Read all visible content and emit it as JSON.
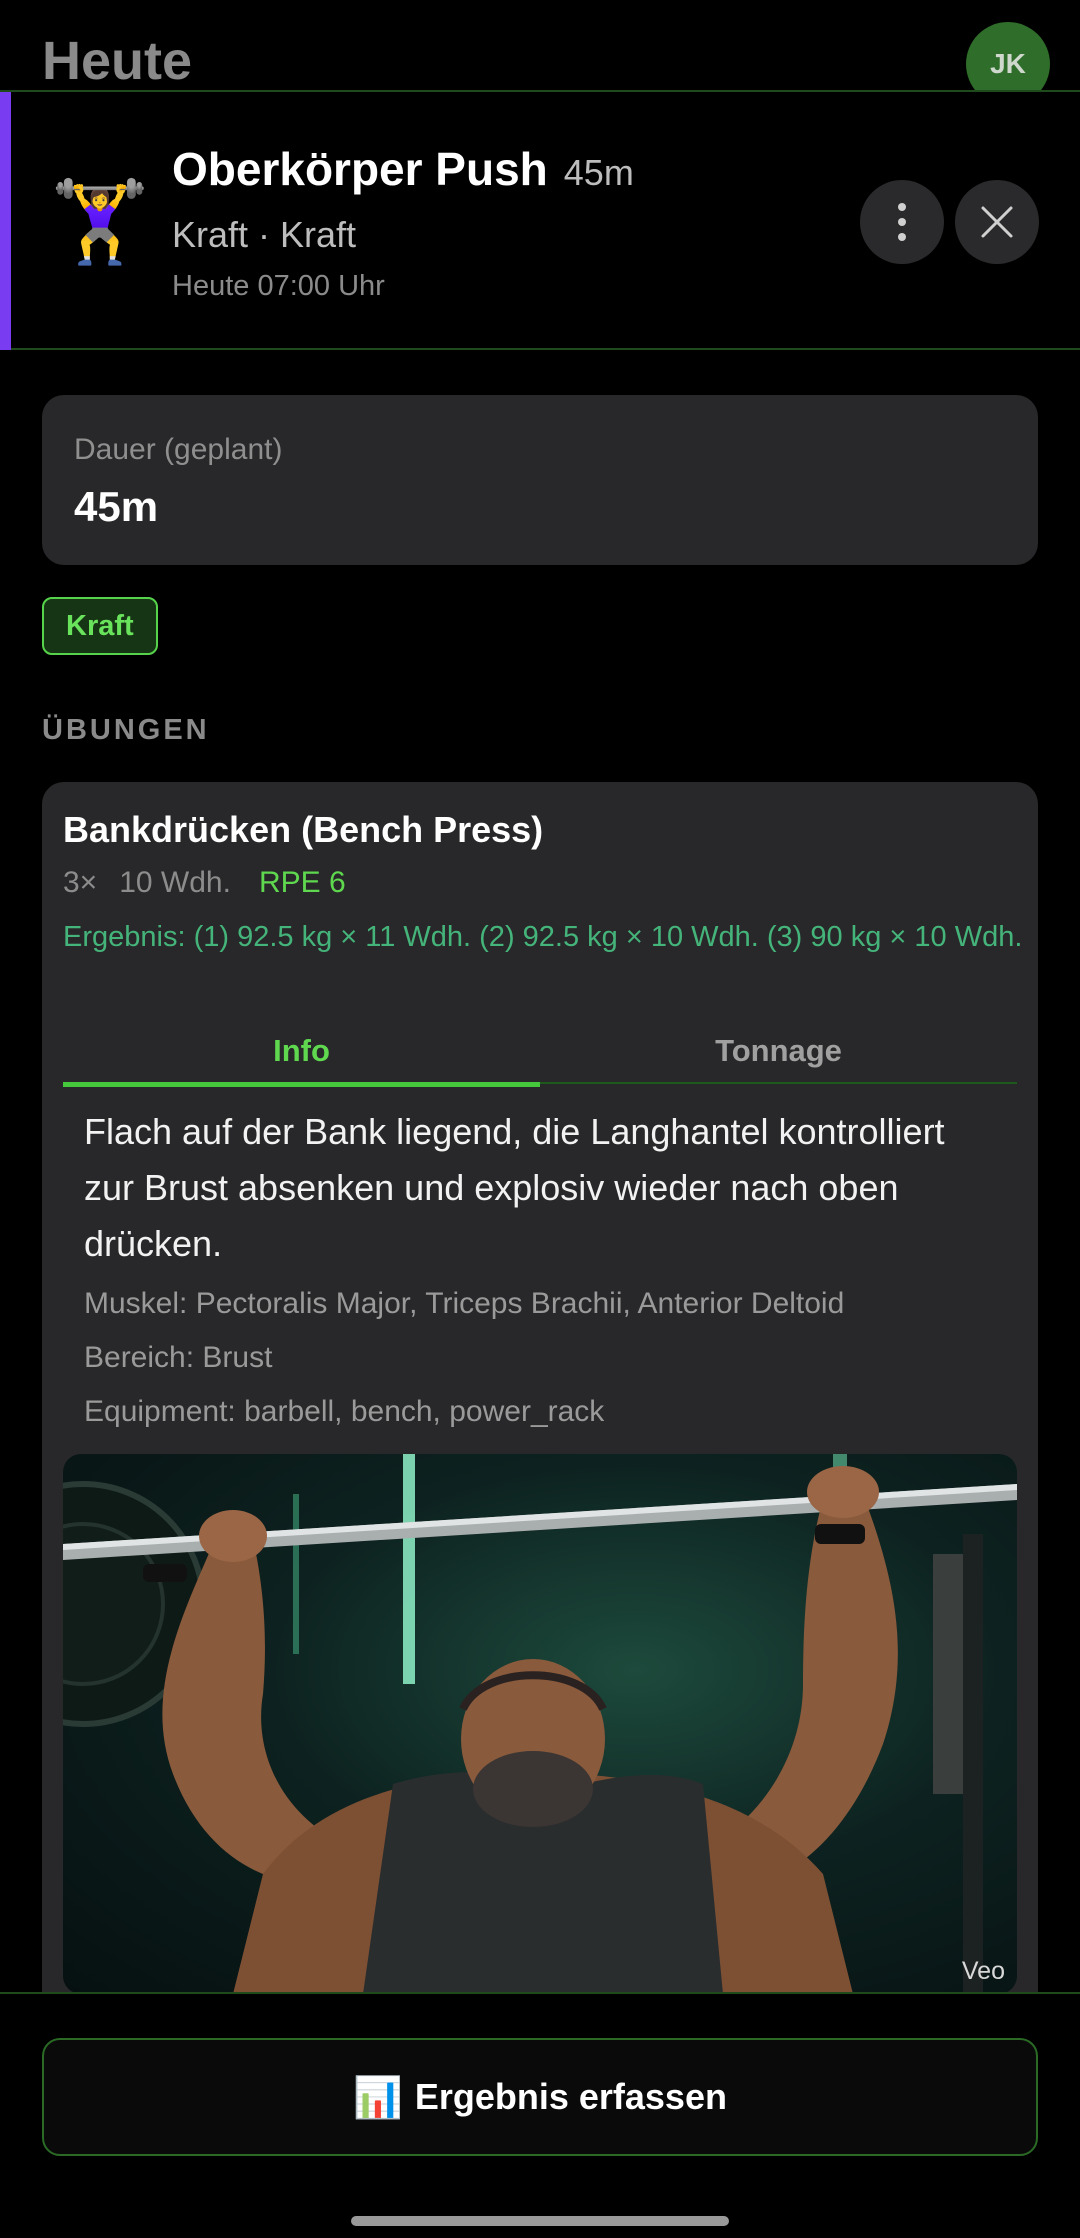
{
  "background": {
    "title": "Heute",
    "avatar_initials": "JK"
  },
  "workout": {
    "icon": "🏋️‍♀️",
    "name": "Oberkörper Push",
    "duration": "45m",
    "subtitle": "Kraft · Kraft",
    "time": "Heute 07:00 Uhr",
    "accent_color": "#7a3cf0"
  },
  "duration_card": {
    "label": "Dauer (geplant)",
    "value": "45m"
  },
  "tag": "Kraft",
  "section_label": "ÜBUNGEN",
  "exercise": {
    "title": "Bankdrücken (Bench Press)",
    "sets": "3×",
    "reps": "10 Wdh.",
    "rpe": "RPE 6",
    "result": "Ergebnis: (1) 92.5 kg × 11 Wdh. (2) 92.5 kg × 10 Wdh. (3) 90 kg × 10 Wdh.",
    "tabs": [
      {
        "label": "Info",
        "active": true
      },
      {
        "label": "Tonnage",
        "active": false
      }
    ],
    "description": "Flach auf der Bank liegend, die Langhantel kontrolliert zur Brust absenken und explosiv wieder nach oben drücken.",
    "muscles": "Muskel: Pectoralis Major, Triceps Brachii, Anterior Deltoid",
    "area": "Bereich: Brust",
    "equipment": "Equipment: barbell, bench, power_rack",
    "image_watermark": "Veo"
  },
  "cta": {
    "icon": "📊",
    "label": "Ergebnis erfassen"
  },
  "colors": {
    "accent_green": "#5fd84f",
    "result_green": "#45b47a",
    "card_bg": "#28282a"
  }
}
